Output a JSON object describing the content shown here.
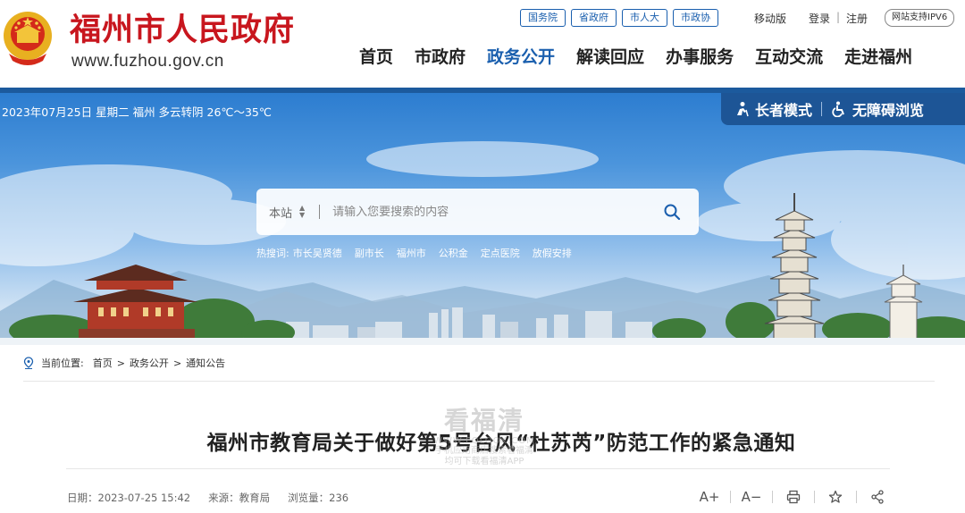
{
  "header": {
    "site_title": "福州市人民政府",
    "site_url": "www.fuzhou.gov.cn",
    "gov_links": [
      "国务院",
      "省政府",
      "市人大",
      "市政协"
    ],
    "mobile": "移动版",
    "login": "登录",
    "separator": "|",
    "register": "注册",
    "ipv6": "网站支持IPV6",
    "nav": [
      {
        "label": "首页",
        "active": false
      },
      {
        "label": "市政府",
        "active": false
      },
      {
        "label": "政务公开",
        "active": true
      },
      {
        "label": "解读回应",
        "active": false
      },
      {
        "label": "办事服务",
        "active": false
      },
      {
        "label": "互动交流",
        "active": false
      },
      {
        "label": "走进福州",
        "active": false
      }
    ]
  },
  "banner": {
    "weather": "2023年07月25日 星期二  福州 多云转阴 26℃～35℃",
    "elder_mode": "长者模式",
    "accessible": "无障碍浏览",
    "search": {
      "scope": "本站",
      "placeholder": "请输入您要搜索的内容"
    },
    "hot_label": "热搜词:",
    "hot_words": [
      "市长吴贤德",
      "副市长",
      "福州市",
      "公积金",
      "定点医院",
      "放假安排"
    ]
  },
  "article": {
    "breadcrumb_label": "当前位置:",
    "breadcrumb": [
      "首页",
      "政务公开",
      "通知公告"
    ],
    "title": "福州市教育局关于做好第5号台风“杜苏芮”防范工作的紧急通知",
    "date": "日期：2023-07-25 15:42",
    "source": "来源：教育局",
    "views": "浏览量：236",
    "tools": {
      "font_up": "A+",
      "font_down": "A−"
    }
  },
  "watermark": {
    "big": "看福清",
    "url": "WWW.FQLOOK.COM",
    "line1": "手机应用商店搜索看福清",
    "line2": "均可下载看福清APP"
  },
  "colors": {
    "brand_red": "#c8161e",
    "accent_blue": "#1a5fae",
    "access_bar": "#1d5596"
  }
}
